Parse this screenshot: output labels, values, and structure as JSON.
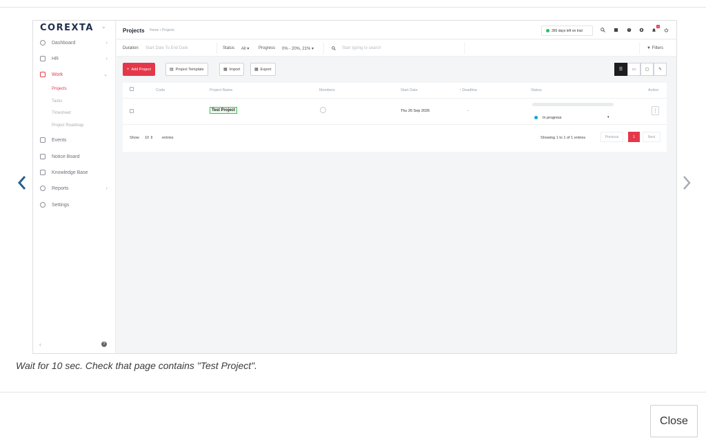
{
  "app": {
    "logo": "COREXTA"
  },
  "sidebar": {
    "items": [
      {
        "label": "Dashboard",
        "icon": "dashboard-icon"
      },
      {
        "label": "HR",
        "icon": "users-icon"
      },
      {
        "label": "Work",
        "icon": "briefcase-icon"
      },
      {
        "label": "Events",
        "icon": "calendar-icon"
      },
      {
        "label": "Notice Board",
        "icon": "clipboard-icon"
      },
      {
        "label": "Knowledge Base",
        "icon": "book-icon"
      },
      {
        "label": "Reports",
        "icon": "chart-icon"
      },
      {
        "label": "Settings",
        "icon": "gear-icon"
      }
    ],
    "work_sub": [
      "Projects",
      "Tasks",
      "Timesheet",
      "Project Roadmap"
    ]
  },
  "header": {
    "title": "Projects",
    "breadcrumb": "Home • Projects",
    "trial": "365 days left on trial",
    "notification_count": "3"
  },
  "filters": {
    "duration_label": "Duration",
    "duration_placeholder": "Start Date To End Date",
    "status_label": "Status",
    "status_value": "All",
    "progress_label": "Progress",
    "progress_value": "0% - 20%, 21%",
    "search_placeholder": "Start typing to search",
    "filters_label": "Filters"
  },
  "toolbar": {
    "add_project": "Add Project",
    "project_template": "Project Template",
    "import": "Import",
    "export": "Export"
  },
  "table": {
    "headers": {
      "code": "Code",
      "name": "Project Name",
      "members": "Members",
      "start": "Start Date",
      "deadline": "Deadline",
      "status": "Status",
      "action": "Action"
    },
    "rows": [
      {
        "name": "Test Project",
        "start": "Thu 26 Sep 2026",
        "deadline": "--",
        "status": "In progress",
        "progress": 0
      }
    ]
  },
  "pagination": {
    "show": "Show",
    "per_page": "10",
    "entries": "entries",
    "summary": "Showing 1 to 1 of 1 entries",
    "previous": "Previous",
    "current": "1",
    "next": "Next"
  },
  "caption": "Wait for 10 sec. Check that page contains \"Test Project\".",
  "dialog": {
    "close": "Close"
  },
  "colors": {
    "accent": "#e4384a",
    "status_dot": "#16a2d8",
    "highlight": "#2ecc40",
    "trial_dot": "#2dbd5d"
  }
}
